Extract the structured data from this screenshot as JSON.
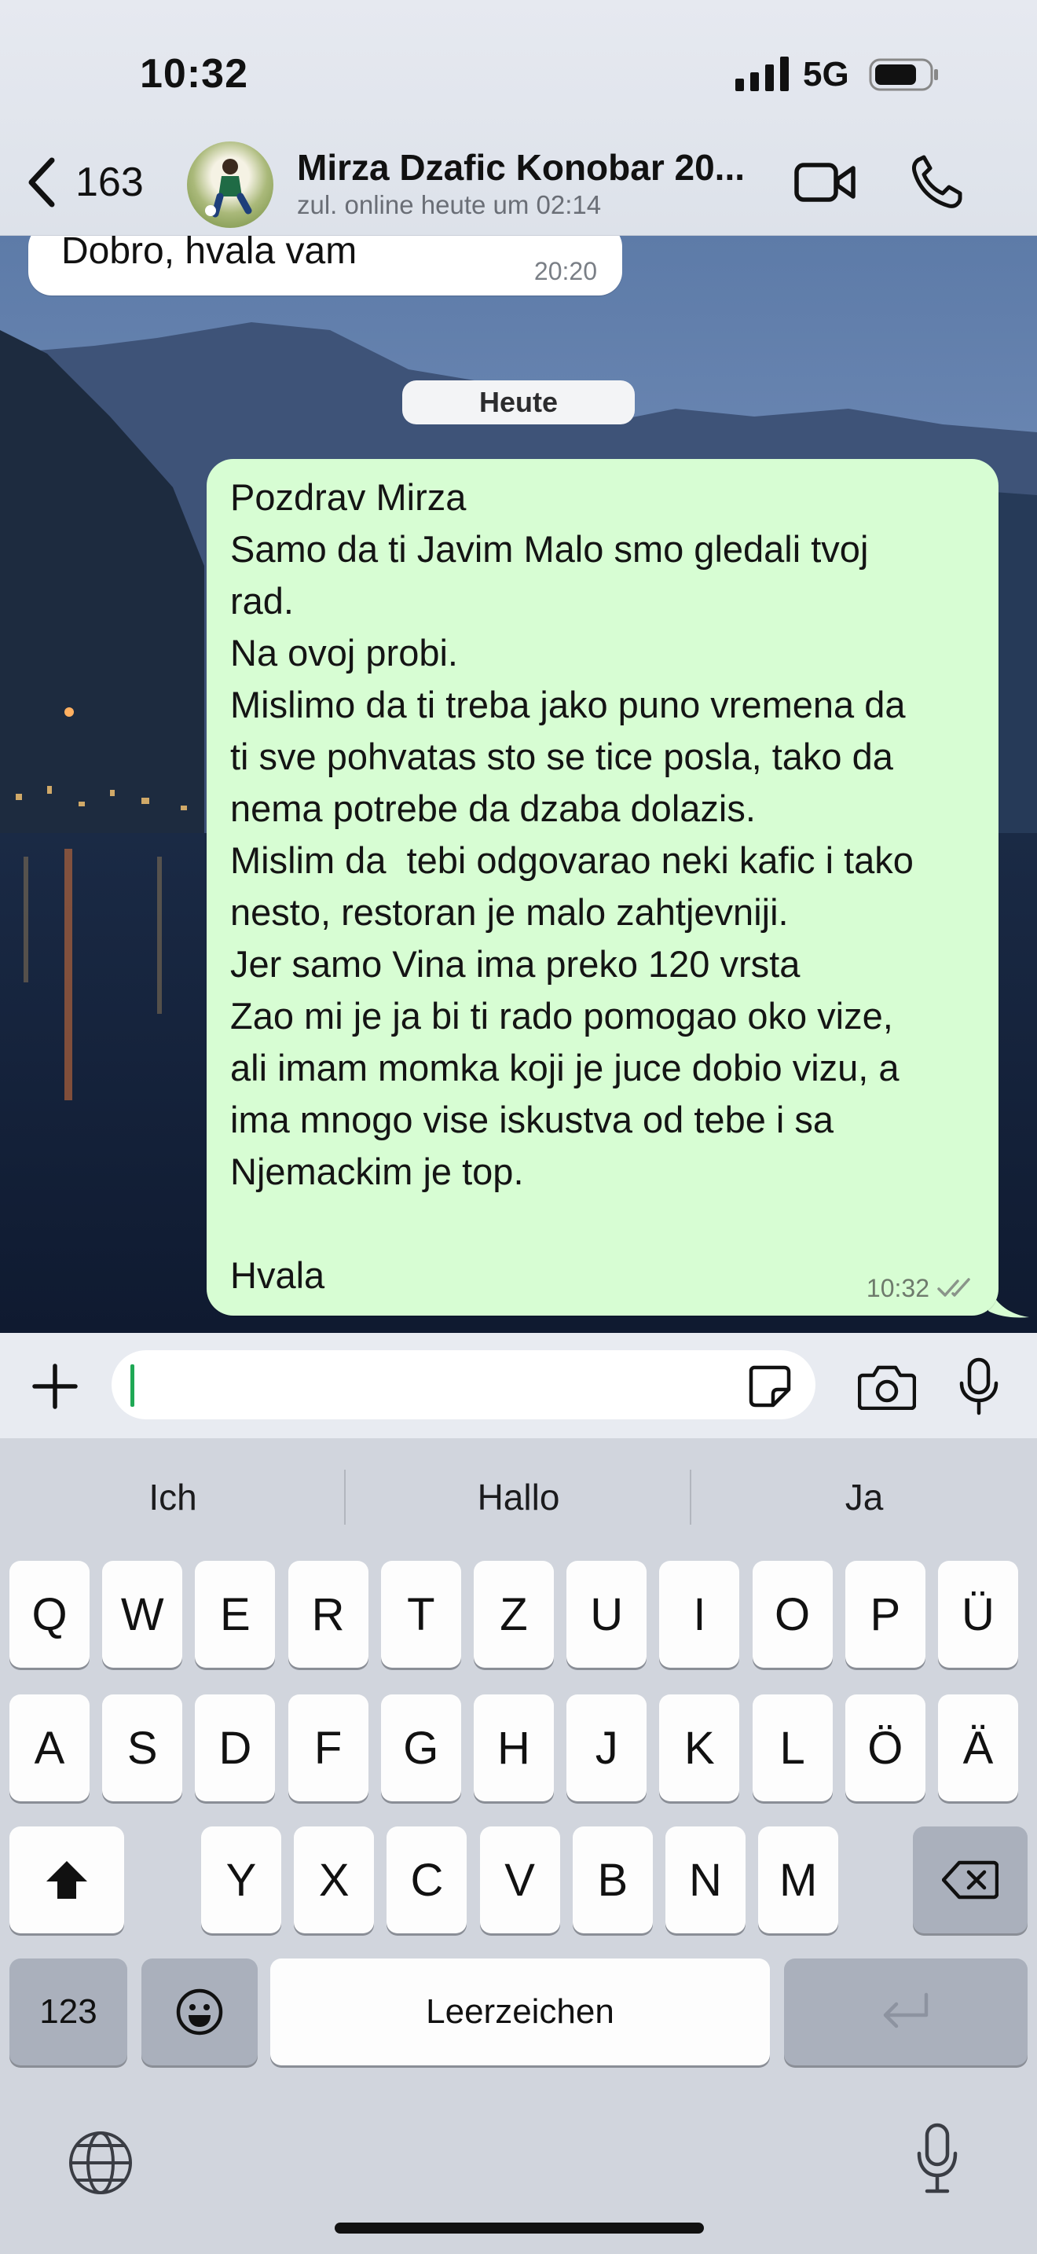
{
  "status_bar": {
    "time": "10:32",
    "network": "5G"
  },
  "header": {
    "back_count": "163",
    "contact_name": "Mirza Dzafic Konobar 20...",
    "contact_status": "zul. online heute um 02:14"
  },
  "chat": {
    "incoming_message": {
      "text": "Dobro, hvala vam",
      "time": "20:20"
    },
    "date_separator": "Heute",
    "outgoing_message": {
      "lines": [
        "Pozdrav Mirza",
        "Samo da ti Javim Malo smo gledali tvoj",
        "rad.",
        "Na ovoj probi.",
        "Mislimo da ti treba jako puno vremena da",
        "ti sve pohvatas sto se tice posla, tako da",
        "nema potrebe da dzaba dolazis.",
        "Mislim da  tebi odgovarao neki kafic i tako",
        "nesto, restoran je malo zahtjevniji.",
        "Jer samo Vina ima preko 120 vrsta",
        "Zao mi je ja bi ti rado pomogao oko vize,",
        "ali imam momka koji je juce dobio vizu, a",
        "ima mnogo vise iskustva od tebe i sa",
        "Njemackim je top.",
        "",
        "Hvala"
      ],
      "time": "10:32",
      "status": "read-ticks"
    }
  },
  "input": {
    "value": ""
  },
  "keyboard": {
    "suggestions": [
      "Ich",
      "Hallo",
      "Ja"
    ],
    "row1": [
      "Q",
      "W",
      "E",
      "R",
      "T",
      "Z",
      "U",
      "I",
      "O",
      "P",
      "Ü"
    ],
    "row2": [
      "A",
      "S",
      "D",
      "F",
      "G",
      "H",
      "J",
      "K",
      "L",
      "Ö",
      "Ä"
    ],
    "row3": [
      "Y",
      "X",
      "C",
      "V",
      "B",
      "N",
      "M"
    ],
    "numbers_key": "123",
    "space_key": "Leerzeichen"
  },
  "colors": {
    "outgoing_bubble": "#d7fdd3",
    "caret": "#1fa855",
    "keyboard_bg": "#d1d5dd"
  }
}
